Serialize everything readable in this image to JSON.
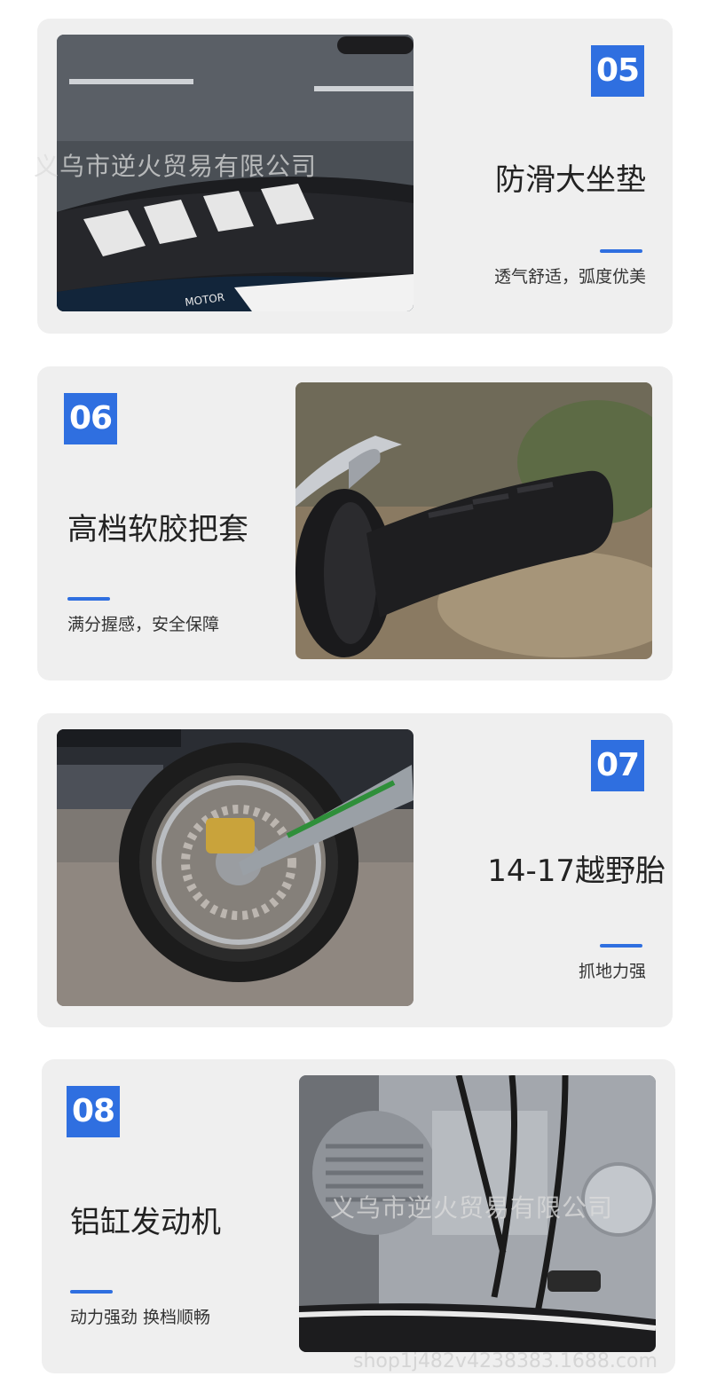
{
  "features": [
    {
      "number": "05",
      "title": "防滑大坐垫",
      "subtitle": "透气舒适，弧度优美",
      "image_icon": "seat-photo-icon"
    },
    {
      "number": "06",
      "title": "高档软胶把套",
      "subtitle": "满分握感，安全保障",
      "image_icon": "handle-grip-photo-icon"
    },
    {
      "number": "07",
      "title": "14-17越野胎",
      "subtitle": "抓地力强",
      "image_icon": "tire-photo-icon"
    },
    {
      "number": "08",
      "title": "铝缸发动机",
      "subtitle": "动力强劲 换档顺畅",
      "image_icon": "engine-photo-icon"
    }
  ],
  "watermark": {
    "text": "义乌市逆火贸易有限公司",
    "url": "shop1j482v4238383.1688.com"
  },
  "colors": {
    "accent": "#2f6fe0",
    "card_bg": "#efefef",
    "title": "#222222"
  }
}
